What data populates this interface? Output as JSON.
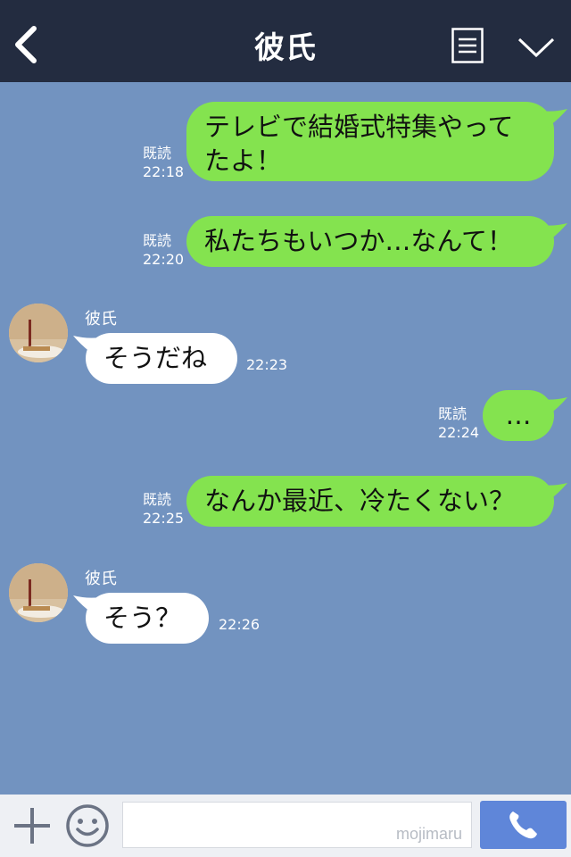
{
  "header": {
    "title": "彼氏",
    "back_icon": "chevron-left-icon",
    "menu_icon": "menu-list-icon",
    "collapse_icon": "chevron-down-icon"
  },
  "messages": [
    {
      "side": "me",
      "lines": [
        "テレビで結婚式特集やって",
        "たよ！"
      ],
      "read": "既読",
      "time": "22:18"
    },
    {
      "side": "me",
      "lines": [
        "私たちもいつか…なんて！"
      ],
      "read": "既読",
      "time": "22:20"
    },
    {
      "side": "them",
      "sender": "彼氏",
      "lines": [
        "そうだね"
      ],
      "time": "22:23"
    },
    {
      "side": "me",
      "lines": [
        "…"
      ],
      "read": "既読",
      "time": "22:24"
    },
    {
      "side": "me",
      "lines": [
        "なんか最近、冷たくない？"
      ],
      "read": "既読",
      "time": "22:25"
    },
    {
      "side": "them",
      "sender": "彼氏",
      "lines": [
        "そう？"
      ],
      "time": "22:26"
    }
  ],
  "bottom_bar": {
    "input_value": "",
    "watermark": "mojimaru",
    "plus_icon": "plus-icon",
    "emoji_icon": "smile-icon",
    "call_icon": "phone-icon"
  },
  "colors": {
    "background": "#7293c0",
    "header": "#232c40",
    "my_bubble": "#84e34f",
    "their_bubble": "#ffffff",
    "call_button": "#5f86d9"
  }
}
